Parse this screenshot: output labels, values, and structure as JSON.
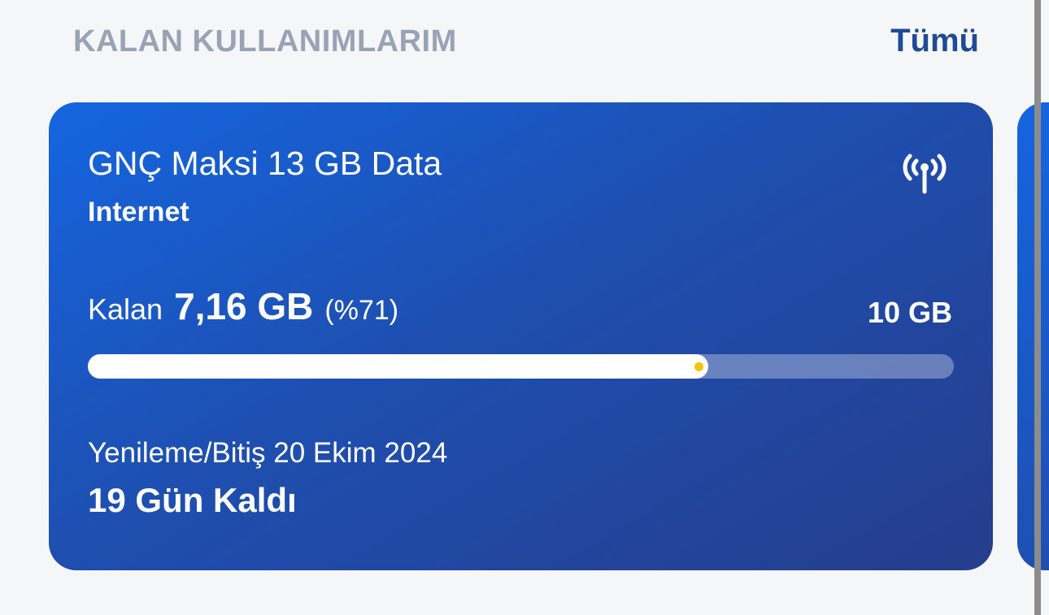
{
  "header": {
    "title": "KALAN KULLANIMLARIM",
    "see_all": "Tümü"
  },
  "usage_card": {
    "package_name": "GNÇ Maksi 13 GB Data",
    "package_type": "Internet",
    "remaining_label": "Kalan",
    "remaining_amount": "7,16 GB",
    "remaining_percent_text": "(%71)",
    "total_amount": "10 GB",
    "progress_fraction": 0.716,
    "renewal_date_text": "Yenileme/Bitiş 20 Ekim 2024",
    "days_left_text": "19 Gün Kaldı",
    "icon": "antenna-signal-icon"
  },
  "colors": {
    "accent": "#1f4a96",
    "card_start": "#1565e0",
    "card_end": "#263d8c",
    "progress_marker": "#f5c400"
  }
}
